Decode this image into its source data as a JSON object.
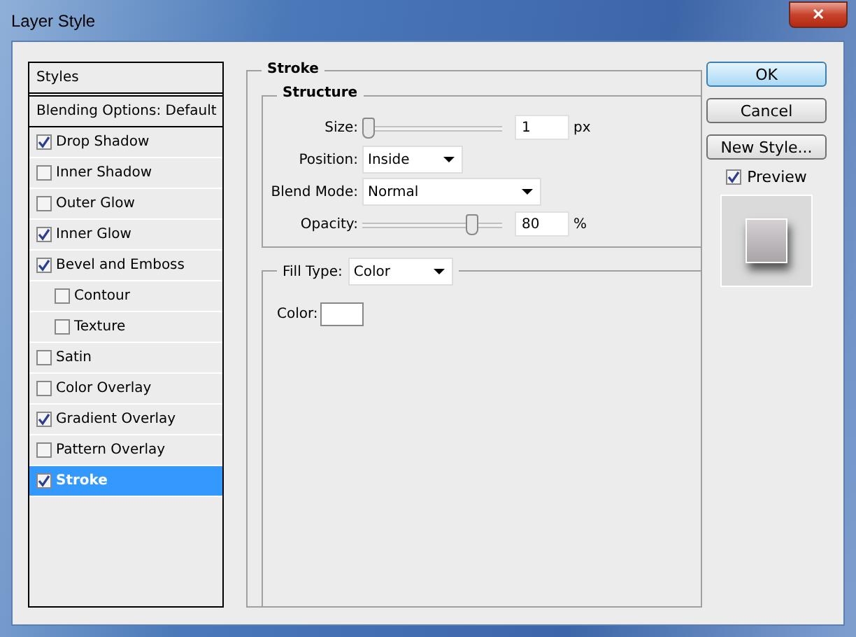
{
  "window": {
    "title": "Layer Style",
    "close": "✕"
  },
  "sidebar": {
    "items": [
      {
        "kind": "header",
        "label": "Styles"
      },
      {
        "kind": "option",
        "label": "Blending Options: Default"
      },
      {
        "kind": "check",
        "label": "Drop Shadow",
        "checked": true,
        "selected": false
      },
      {
        "kind": "check",
        "label": "Inner Shadow",
        "checked": false,
        "selected": false
      },
      {
        "kind": "check",
        "label": "Outer Glow",
        "checked": false,
        "selected": false
      },
      {
        "kind": "check",
        "label": "Inner Glow",
        "checked": true,
        "selected": false
      },
      {
        "kind": "check",
        "label": "Bevel and Emboss",
        "checked": true,
        "selected": false,
        "children": [
          {
            "kind": "check",
            "label": "Contour",
            "checked": false,
            "selected": false
          },
          {
            "kind": "check",
            "label": "Texture",
            "checked": false,
            "selected": false
          }
        ]
      },
      {
        "kind": "check",
        "label": "Satin",
        "checked": false,
        "selected": false
      },
      {
        "kind": "check",
        "label": "Color Overlay",
        "checked": false,
        "selected": false
      },
      {
        "kind": "check",
        "label": "Gradient Overlay",
        "checked": true,
        "selected": false
      },
      {
        "kind": "check",
        "label": "Pattern Overlay",
        "checked": false,
        "selected": false
      },
      {
        "kind": "check",
        "label": "Stroke",
        "checked": true,
        "selected": true
      }
    ]
  },
  "stroke": {
    "title": "Stroke",
    "structure": {
      "title": "Structure",
      "size": {
        "label": "Size:",
        "level": 0.0,
        "value": "1",
        "unit": "px"
      },
      "position": {
        "label": "Position:",
        "value": "Inside"
      },
      "blend_mode": {
        "label": "Blend Mode:",
        "value": "Normal"
      },
      "opacity": {
        "label": "Opacity:",
        "level": 0.8,
        "value": "80",
        "unit": "%"
      }
    },
    "fill_type": {
      "label": "Fill Type:",
      "value": "Color"
    },
    "color": {
      "label": "Color:",
      "color": "#ffffff"
    }
  },
  "buttons": [
    {
      "label": "OK",
      "default": true
    },
    {
      "label": "Cancel",
      "default": false
    },
    {
      "label": "New Style...",
      "default": false
    }
  ],
  "preview": {
    "label": "Preview",
    "checked": true
  }
}
